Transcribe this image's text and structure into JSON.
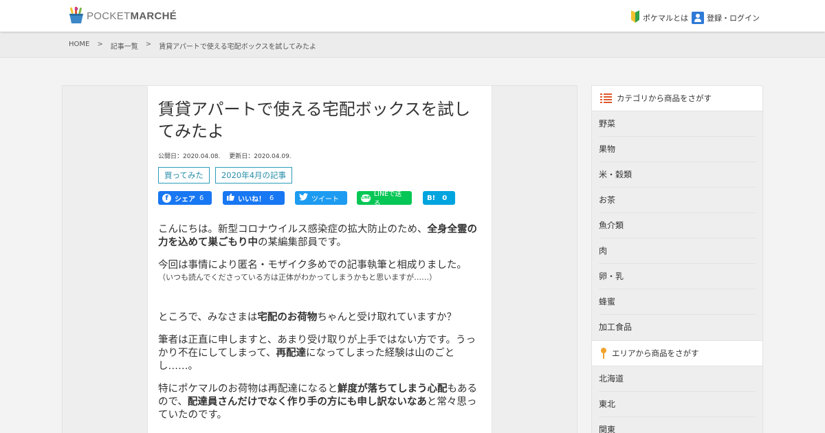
{
  "header": {
    "logo_light": "POCKET",
    "logo_bold": "MARCHÉ",
    "nav": [
      {
        "label": "ポケマルとは",
        "icon": "beginner-mark-icon"
      },
      {
        "label": "登録・ログイン",
        "icon": "user-icon"
      }
    ]
  },
  "breadcrumb": {
    "items": [
      "HOME",
      "記事一覧",
      "賃貸アパートで使える宅配ボックスを試してみたよ"
    ],
    "separator": ">"
  },
  "article": {
    "title": "賃貸アパートで使える宅配ボックスを試してみたよ",
    "published": "公開日：2020.04.08.",
    "updated": "更新日：2020.04.09.",
    "tags": [
      "買ってみた",
      "2020年4月の記事"
    ],
    "share": {
      "facebook": {
        "label": "シェア",
        "count": "6"
      },
      "like": {
        "label": "いいね！",
        "count": "6"
      },
      "twitter": {
        "label": "ツイート"
      },
      "line": {
        "label": "LINEで送る"
      },
      "hatena": {
        "label": "B!",
        "count": "0"
      }
    },
    "body": {
      "p1_a": "こんにちは。新型コロナウイルス感染症の拡大防止のため、",
      "p1_b": "全身全霊の力を込めて巣ごもり中",
      "p1_c": "の某編集部員です。",
      "p2": "今回は事情により匿名・モザイク多めでの記事執筆と相成りました。",
      "p2_small": "（いつも読んでくださっている方は正体がわかってしまうかもと思いますが……）",
      "p3_a": "ところで、みなさまは",
      "p3_b": "宅配のお荷物",
      "p3_c": "ちゃんと受け取れていますか？",
      "p4_a": "筆者は正直に申しますと、あまり受け取りが上手ではない方です。うっかり不在にしてしまって、",
      "p4_b": "再配達",
      "p4_c": "になってしまった経験は山のごとし……。",
      "p5_a": "特にポケマルのお荷物は再配達になると",
      "p5_b": "鮮度が落ちてしまう心配",
      "p5_c": "もあるので、",
      "p5_d": "配達員さんだけでなく作り手の方にも申し訳ないなあ",
      "p5_e": "と常々思っていたのです。"
    }
  },
  "sidebar": {
    "category_heading": "カテゴリから商品をさがす",
    "categories": [
      "野菜",
      "果物",
      "米・穀類",
      "お茶",
      "魚介類",
      "肉",
      "卵・乳",
      "蜂蜜",
      "加工食品"
    ],
    "area_heading": "エリアから商品をさがす",
    "areas": [
      "北海道",
      "東北",
      "関東"
    ]
  },
  "colors": {
    "tag_accent": "#2a9bb8",
    "facebook": "#1877f2",
    "twitter": "#1d9bf0",
    "line": "#06c755",
    "hatena": "#00a4de",
    "category_icon": "#e0562c",
    "area_icon": "#f0a22a"
  }
}
